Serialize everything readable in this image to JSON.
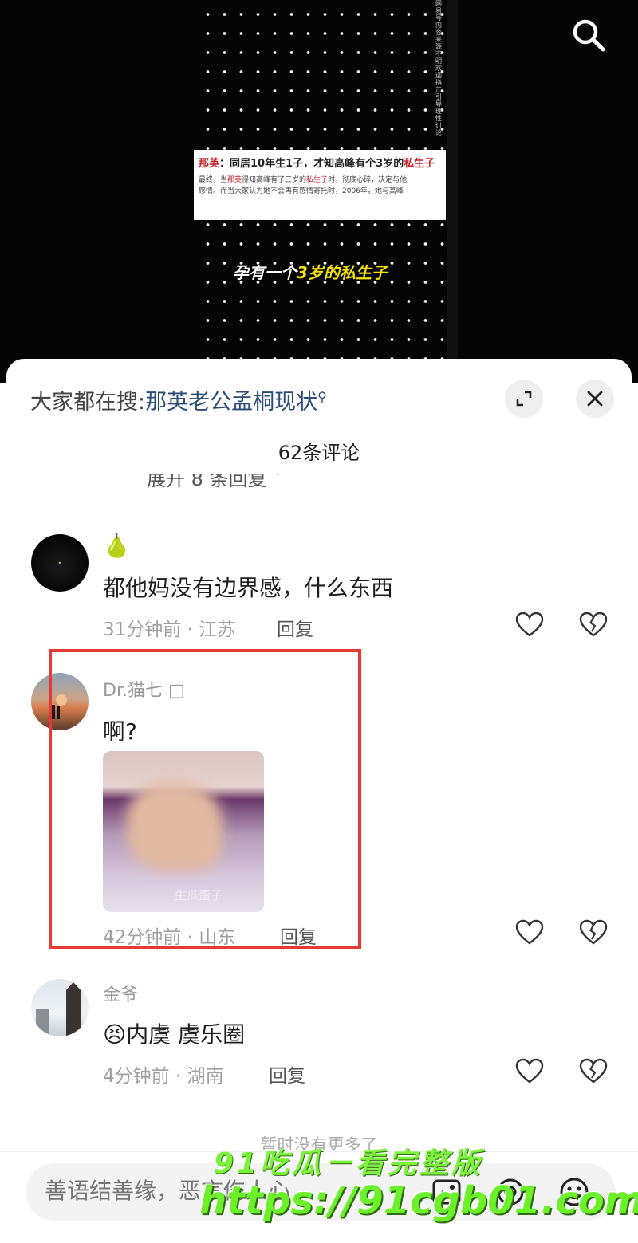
{
  "video": {
    "card_headline_a": "那英",
    "card_headline_b": "：同居10年生1子，才知高峰有个3岁的",
    "card_headline_c": "私生子",
    "card_body_a": "最终，当",
    "card_body_b": "那英",
    "card_body_c": "得知高峰有了三岁的",
    "card_body_d": "私生子",
    "card_body_e": "时，彻底心碎，决定与他",
    "card_body_f": "感情。而当大家认为她不会再有感情寄托时，2006年，她与高峰",
    "subtitle_a": "孕有一个",
    "subtitle_b": "3岁的私生子",
    "side_text": "网易号内容来源不明欢迎指正引导理性讨论"
  },
  "sheet": {
    "hot_search_label": "大家都在搜:",
    "hot_search_term": "那英老公孟桐现状",
    "hot_search_icon": "search-small-icon",
    "comment_count": "62条评论",
    "partial_line": "展开 8 条回复 ˅"
  },
  "comments": [
    {
      "username": "🍐",
      "text": "都他妈没有边界感，什么东西",
      "time_location": "31分钟前 · 江苏",
      "reply_label": "回复"
    },
    {
      "username": "Dr.猫七",
      "username_badge": "□",
      "text": "啊?",
      "image_watermark": "生瓜蛋子",
      "time_location": "42分钟前 · 山东",
      "reply_label": "回复"
    },
    {
      "username": "金爷",
      "emoji": "😣",
      "text": "内虞 虞乐圈",
      "time_location": "4分钟前 · 湖南",
      "reply_label": "回复"
    }
  ],
  "end_tip": "暂时没有更多了",
  "input": {
    "placeholder": "善语结善缘，恶言伤人心"
  },
  "watermark": {
    "line1": "91吃瓜－看完整版",
    "line2": "https://91cgb01.com"
  },
  "colors": {
    "highlight_box": "#e53935",
    "hot_search_term": "#2a4a78",
    "watermark": "#6cf02a"
  }
}
